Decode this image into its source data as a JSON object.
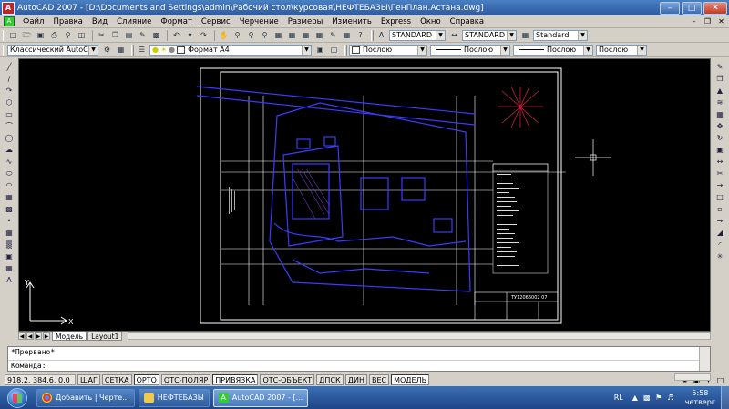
{
  "window": {
    "title": "AutoCAD 2007 - [D:\\Documents and Settings\\admin\\Рабочий стол\\курсовая\\НЕФТЕБАЗЫ\\ГенПлан.Астана.dwg]",
    "app_icon": "autocad-logo-icon",
    "controls": [
      "minimize-icon",
      "maximize-icon",
      "close-icon"
    ]
  },
  "menu": {
    "items": [
      "Файл",
      "Правка",
      "Вид",
      "Слияние",
      "Формат",
      "Сервис",
      "Черчение",
      "Размеры",
      "Изменить",
      "Express",
      "Окно",
      "Справка"
    ]
  },
  "toolbar1": {
    "text_style": "STANDARD",
    "dim_style": "STANDARD",
    "table_style": "Standard"
  },
  "toolbar2": {
    "workspace": "Классический AutoCAD",
    "layer": "Формат А4",
    "color": "Послою",
    "linetype": "Послою",
    "lineweight": "Послою",
    "plotstyle": "Послою"
  },
  "drawing": {
    "background": "#000000",
    "frame_color": "#ffffff",
    "plan_color": "#3b3bff",
    "title_block": {
      "code": "ТУ12066002 07"
    },
    "ucs": {
      "y_label": "Y",
      "x_label": "X"
    }
  },
  "tabs": {
    "items": [
      "Модель",
      "Layout1"
    ],
    "active": "Модель"
  },
  "command": {
    "history": "*Прервано*",
    "prompt": "Команда:"
  },
  "status": {
    "coords": "918.2,  384.6, 0.0",
    "buttons": [
      {
        "label": "ШАГ",
        "on": false
      },
      {
        "label": "СЕТКА",
        "on": false
      },
      {
        "label": "ОРТО",
        "on": true
      },
      {
        "label": "ОТС-ПОЛЯР",
        "on": false
      },
      {
        "label": "ПРИВЯЗКА",
        "on": true
      },
      {
        "label": "ОТС-ОБЪЕКТ",
        "on": false
      },
      {
        "label": "ДПСК",
        "on": false
      },
      {
        "label": "ДИН",
        "on": false
      },
      {
        "label": "ВЕС",
        "on": false
      },
      {
        "label": "МОДЕЛЬ",
        "on": true
      }
    ]
  },
  "taskbar": {
    "buttons": [
      {
        "label": "Добавить | Черте...",
        "icon": "chrome-icon",
        "active": false
      },
      {
        "label": "НЕФТЕБАЗЫ",
        "icon": "folder-icon",
        "active": false
      },
      {
        "label": "AutoCAD 2007 - [...",
        "icon": "autocad-icon",
        "active": true
      }
    ],
    "lang": "RL",
    "time": "5:58",
    "day": "четверг"
  }
}
